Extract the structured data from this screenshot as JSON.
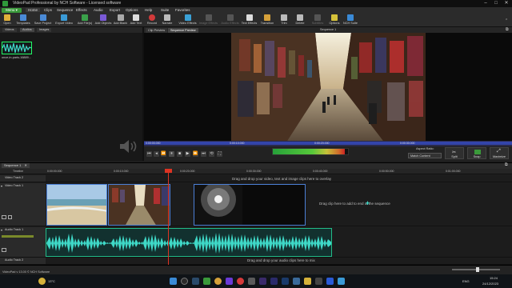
{
  "window": {
    "title": "VideoPad Professional by NCH Software - Licensed software",
    "controls": [
      "–",
      "□",
      "✕"
    ]
  },
  "menubar": {
    "menu_button": "Menu ▾",
    "items": [
      "Home",
      "Clips",
      "Sequence",
      "Effects",
      "Audio",
      "Export",
      "Options",
      "Help",
      "Suite",
      "Favorites"
    ]
  },
  "toolbar": [
    {
      "label": "Open",
      "icon": "folder-icon",
      "color": "#e0b03a",
      "enabled": true
    },
    {
      "label": "Templates",
      "icon": "template-icon",
      "color": "#4a8ad6",
      "enabled": true
    },
    {
      "label": "Save Project",
      "icon": "save-icon",
      "color": "#4a8ad6",
      "enabled": true
    },
    {
      "label": "Export Video",
      "icon": "export-icon",
      "color": "#3a9ad6",
      "enabled": true
    },
    {
      "label": "Add File(s)",
      "icon": "add-file-icon",
      "color": "#3aa14a",
      "enabled": true
    },
    {
      "label": "Add Objects",
      "icon": "objects-icon",
      "color": "#7a5ad6",
      "enabled": true
    },
    {
      "label": "Add Blank",
      "icon": "blank-icon",
      "color": "#aaaaaa",
      "enabled": true
    },
    {
      "label": "Add Text",
      "icon": "text-icon",
      "color": "#dddddd",
      "enabled": true
    },
    {
      "label": "Record",
      "icon": "record-icon",
      "color": "#d23a3a",
      "enabled": true
    },
    {
      "label": "Narrate",
      "icon": "narrate-icon",
      "color": "#bbbbbb",
      "enabled": true
    },
    {
      "label": "Video Effects",
      "icon": "video-effects-icon",
      "color": "#3aa1d6",
      "enabled": true
    },
    {
      "label": "Image Effects",
      "icon": "image-effects-icon",
      "color": "#555555",
      "enabled": false
    },
    {
      "label": "Audio Effects",
      "icon": "audio-effects-icon",
      "color": "#555555",
      "enabled": false
    },
    {
      "label": "Text Effects",
      "icon": "text-effects-icon",
      "color": "#dddddd",
      "enabled": true
    },
    {
      "label": "Transition",
      "icon": "transition-icon",
      "color": "#d6a13a",
      "enabled": true
    },
    {
      "label": "Trim",
      "icon": "trim-icon",
      "color": "#bbbbbb",
      "enabled": true
    },
    {
      "label": "Delete",
      "icon": "delete-icon",
      "color": "#bbbbbb",
      "enabled": true
    },
    {
      "label": "Subtitles",
      "icon": "subtitles-icon",
      "color": "#555555",
      "enabled": false
    },
    {
      "label": "Options",
      "icon": "options-icon",
      "color": "#d6c23a",
      "enabled": true
    },
    {
      "label": "NCH Suite",
      "icon": "suite-icon",
      "color": "#3a8ad6",
      "enabled": true
    }
  ],
  "bins": {
    "tabs": [
      "Videos",
      "Audios",
      "Images"
    ],
    "clip_label": "once-in-paris-16889..."
  },
  "preview": {
    "tabs": [
      "Clip Preview",
      "Sequence Preview"
    ],
    "active_tab": "Sequence Preview",
    "sequence_label": "Sequence 1",
    "times": [
      "0:00:00.000",
      "0:00:10.000",
      "0:00:20.000",
      "0:00:30.000"
    ],
    "aspect_label": "Aspect Ratio:",
    "aspect_value": "Match Content",
    "buttons": [
      "Split",
      "Snap",
      "Maximize"
    ]
  },
  "sequence": {
    "tab_label": "Sequence 1",
    "close_icon": "✕",
    "timeline_label": "Timeline",
    "ruler": [
      "0:00:00.000",
      "0:00:10.000",
      "0:00:20.000",
      "0:00:30.000",
      "0:00:40.000",
      "0:00:50.000",
      "0:01:00.000"
    ],
    "overlay_track": "Video Track 2",
    "overlay_hint": "Drag and drop your video, text and image clips here to overlay",
    "video_track": "Video Track 1",
    "video_hint": "Drag clip here to add to end of the sequence",
    "audio_track": "Audio Track 1",
    "audio_track2": "Audio Track 2",
    "audio_hint": "Drag and drop your audio clips here to mix"
  },
  "statusbar": {
    "text": "VideoPad v 13.00 © NCH Software"
  },
  "taskbar": {
    "weather": "13°C",
    "time": "15:24",
    "date": "24/12/2023",
    "lang": "ENG"
  }
}
